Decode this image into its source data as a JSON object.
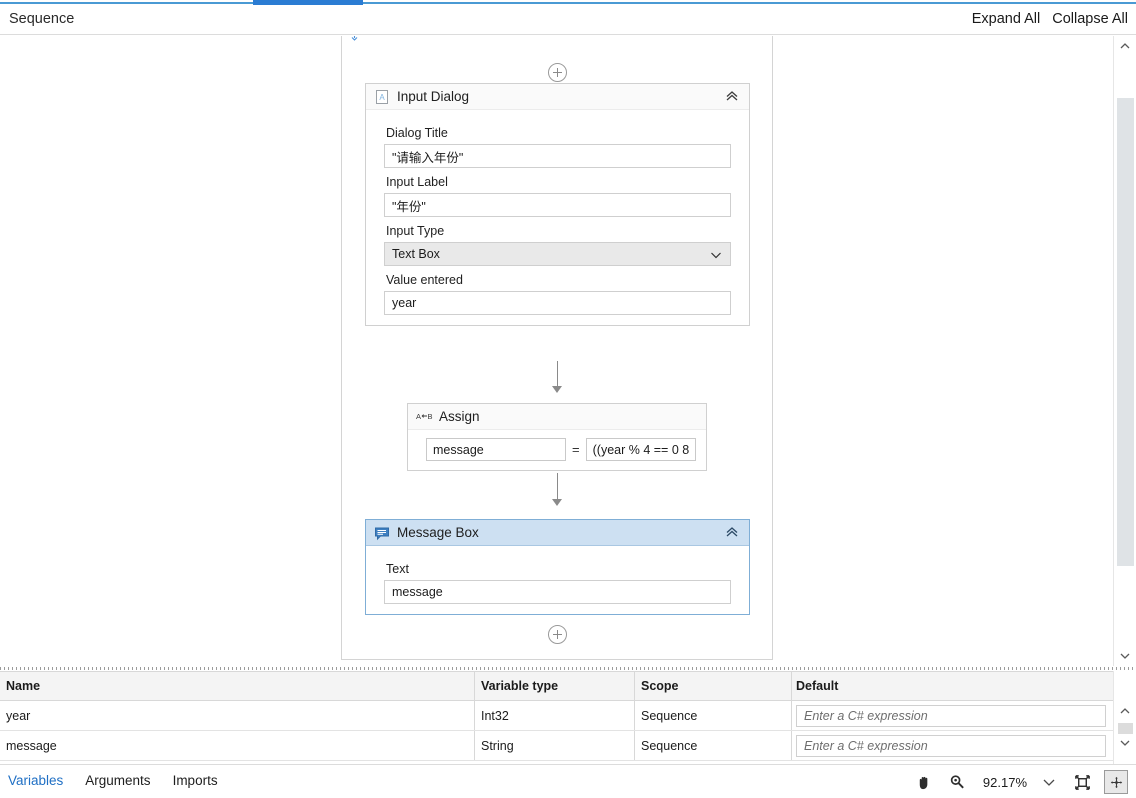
{
  "header": {
    "title": "Sequence",
    "expand_all": "Expand All",
    "collapse_all": "Collapse All"
  },
  "canvas": {
    "sequence_name": "Sequence",
    "activities": [
      {
        "name": "Input Dialog",
        "icon": "input-dialog-icon",
        "selected": false,
        "collapse_icon": "chevron-double-up-icon",
        "fields": [
          {
            "label": "Dialog Title",
            "value": "\"请输入年份\"",
            "kind": "text"
          },
          {
            "label": "Input Label",
            "value": "\"年份\"",
            "kind": "text"
          },
          {
            "label": "Input Type",
            "value": "Text Box",
            "kind": "select"
          },
          {
            "label": "Value entered",
            "value": "year",
            "kind": "text"
          }
        ]
      },
      {
        "name": "Assign",
        "icon": "assign-icon",
        "icon_text": "A←B",
        "selected": false,
        "to": "message",
        "operator": "=",
        "value": "((year % 4 == 0 8"
      },
      {
        "name": "Message Box",
        "icon": "message-box-icon",
        "selected": true,
        "collapse_icon": "chevron-double-up-icon",
        "fields": [
          {
            "label": "Text",
            "value": "message",
            "kind": "text"
          }
        ]
      }
    ]
  },
  "variables_panel": {
    "columns": [
      "Name",
      "Variable type",
      "Scope",
      "Default"
    ],
    "rows": [
      {
        "name": "year",
        "type": "Int32",
        "scope": "Sequence",
        "default_placeholder": "Enter a C# expression"
      },
      {
        "name": "message",
        "type": "String",
        "scope": "Sequence",
        "default_placeholder": "Enter a C# expression"
      }
    ]
  },
  "status_bar": {
    "tabs": [
      {
        "label": "Variables",
        "active": true
      },
      {
        "label": "Arguments",
        "active": false
      },
      {
        "label": "Imports",
        "active": false
      }
    ],
    "zoom_level": "92.17%",
    "tools": [
      "pan-hand-icon",
      "zoom-magnifier-icon",
      "chevron-down-icon",
      "fit-to-screen-icon",
      "overview-map-icon"
    ]
  },
  "colors": {
    "accent_blue": "#2b7cd3",
    "selected_header": "#cde0f2",
    "selected_border": "#7faed6",
    "link_blue": "#1f6fc4"
  }
}
